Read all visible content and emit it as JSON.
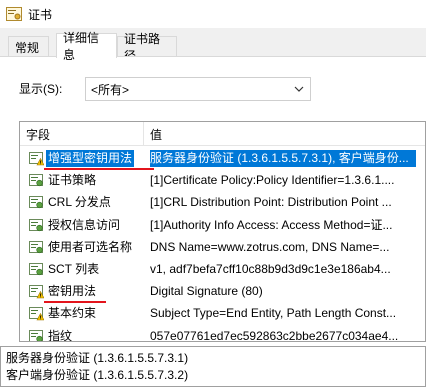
{
  "window": {
    "title": "证书"
  },
  "tabs": [
    {
      "label": "常规"
    },
    {
      "label": "详细信息"
    },
    {
      "label": "证书路径"
    }
  ],
  "show": {
    "label": "显示(S):",
    "selected": "<所有>"
  },
  "list": {
    "columns": {
      "field": "字段",
      "value": "值"
    },
    "rows": [
      {
        "field": "增强型密钥用法",
        "value": "服务器身份验证 (1.3.6.1.5.5.7.3.1), 客户端身份...",
        "icon": "cert-extension-warning-icon",
        "selected": true
      },
      {
        "field": "证书策略",
        "value": "[1]Certificate Policy:Policy Identifier=1.3.6.1....",
        "icon": "cert-extension-icon"
      },
      {
        "field": "CRL 分发点",
        "value": "[1]CRL Distribution Point: Distribution Point ...",
        "icon": "cert-extension-icon"
      },
      {
        "field": "授权信息访问",
        "value": "[1]Authority Info Access: Access Method=证...",
        "icon": "cert-extension-icon"
      },
      {
        "field": "使用者可选名称",
        "value": "DNS Name=www.zotrus.com, DNS Name=...",
        "icon": "cert-extension-icon"
      },
      {
        "field": "SCT 列表",
        "value": "v1, adf7befa7cff10c88b9d3d9c1e3e186ab4...",
        "icon": "cert-extension-icon"
      },
      {
        "field": "密钥用法",
        "value": "Digital Signature (80)",
        "icon": "cert-extension-warning-icon"
      },
      {
        "field": "基本约束",
        "value": "Subject Type=End Entity, Path Length Const...",
        "icon": "cert-extension-icon"
      },
      {
        "field": "指纹",
        "value": "057e07761ed7ec592863c2bbe2677c034ae4...",
        "icon": "cert-extension-icon"
      }
    ]
  },
  "detail": {
    "lines": [
      "服务器身份验证 (1.3.6.1.5.5.7.3.1)",
      "客户端身份验证 (1.3.6.1.5.5.7.3.2)"
    ]
  }
}
